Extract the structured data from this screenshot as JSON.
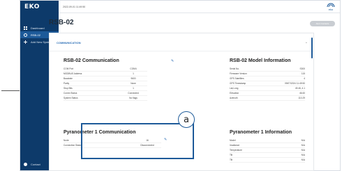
{
  "app": {
    "logo": "EKO",
    "timestamp": "2022-09-01 11:49:50",
    "brand_label": "eko"
  },
  "sidebar": {
    "items": [
      {
        "label": "Dashboard",
        "icon": "dashboard-icon",
        "active": false
      },
      {
        "label": "RSB-02",
        "icon": "device-icon",
        "active": true
      },
      {
        "label": "Add New System",
        "icon": "plus-icon",
        "active": false
      }
    ],
    "contact": "Contact"
  },
  "page": {
    "title": "RSB-02",
    "alert_button": "Alert Contacts"
  },
  "section": {
    "label": "COMMUNICATION",
    "collapse_icon": "chevron-down-icon"
  },
  "rsb_comm": {
    "title": "RSB-02 Communication",
    "rows": [
      {
        "label": "COM Port",
        "value": "COM4"
      },
      {
        "label": "MODBUS Address",
        "value": "1"
      },
      {
        "label": "Baudrate",
        "value": "9600"
      },
      {
        "label": "Parity",
        "value": "None"
      },
      {
        "label": "Stop Bits",
        "value": "1"
      },
      {
        "label": "Comm Status",
        "value": "Connected"
      },
      {
        "label": "System Status",
        "value": "No flags"
      }
    ]
  },
  "rsb_model": {
    "title": "RSB-02 Model Information",
    "rows": [
      {
        "label": "Serial No.",
        "value": "S300"
      },
      {
        "label": "Firmware Version",
        "value": "115"
      },
      {
        "label": "GPS Satellites",
        "value": "4"
      },
      {
        "label": "GPS Timestamp",
        "value": "09/07/2024 11:49:50"
      },
      {
        "label": "Lat,Long",
        "value": "49.46, 4.1"
      },
      {
        "label": "Elevation",
        "value": "46.60"
      },
      {
        "label": "Azimuth",
        "value": "110.29"
      }
    ]
  },
  "pyr_comm": {
    "title": "Pyranometer 1 Communication",
    "rows": [
      {
        "label": "Node",
        "value": "16"
      },
      {
        "label": "Connection Status",
        "value": "Disconnected"
      }
    ]
  },
  "pyr_info": {
    "title": "Pyranometer 1 Information",
    "rows": [
      {
        "label": "Model",
        "value": "N/A"
      },
      {
        "label": "Irradiance",
        "value": "N/A"
      },
      {
        "label": "Temperature",
        "value": "N/A"
      },
      {
        "label": "Tilt",
        "value": "N/A"
      },
      {
        "label": "Tilt",
        "value": "N/A"
      }
    ]
  },
  "annotation": {
    "callout_letter": "a"
  },
  "colors": {
    "sidebar": "#0d3a6a",
    "active": "#1d5a99",
    "accent": "#2a6db5"
  }
}
